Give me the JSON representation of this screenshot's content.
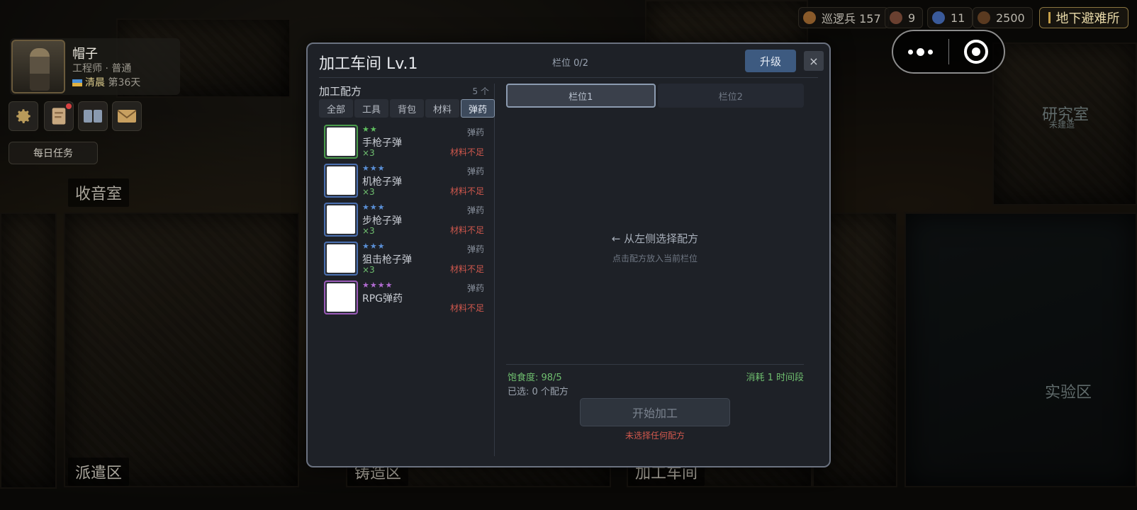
{
  "player": {
    "name": "帽子",
    "role": "工程师 · 普通",
    "time_of_day": "清晨",
    "day": "第36天"
  },
  "hud": {
    "daily_tasks": "每日任务",
    "notification_badge": true
  },
  "resources": [
    {
      "icon": "patrol-icon",
      "label": "巡逻兵 157",
      "color": "#8a5a2a"
    },
    {
      "icon": "ore-icon",
      "label": "9",
      "color": "#6a4030"
    },
    {
      "icon": "crystal-icon",
      "label": "11",
      "color": "#3a5a9a"
    },
    {
      "icon": "coin-icon",
      "label": "2500",
      "color": "#5a3a20"
    }
  ],
  "location": "地下避难所",
  "rooms": {
    "radio": "收音室",
    "research": "研究室",
    "research_status": "未建造",
    "lab": "实验区",
    "dispatch": "派遣区",
    "forge": "铸造区",
    "workshop": "加工车间"
  },
  "modal": {
    "title": "加工车间  Lv.1",
    "slots_used": "栏位 0/2",
    "upgrade": "升级",
    "close": "×",
    "recipes_title": "加工配方",
    "recipes_count": "5 个",
    "tabs": [
      "全部",
      "工具",
      "背包",
      "材料",
      "弹药"
    ],
    "active_tab": 4,
    "recipes": [
      {
        "stars": "★★",
        "star_color": "#5fbf5f",
        "border": "#4b9c4b",
        "name": "手枪子弹",
        "qty": "×3",
        "category": "弹药",
        "status": "材料不足"
      },
      {
        "stars": "★★★",
        "star_color": "#5a8fd6",
        "border": "#4a6fb0",
        "name": "机枪子弹",
        "qty": "×3",
        "category": "弹药",
        "status": "材料不足"
      },
      {
        "stars": "★★★",
        "star_color": "#5a8fd6",
        "border": "#4a6fb0",
        "name": "步枪子弹",
        "qty": "×3",
        "category": "弹药",
        "status": "材料不足"
      },
      {
        "stars": "★★★",
        "star_color": "#5a8fd6",
        "border": "#4a6fb0",
        "name": "狙击枪子弹",
        "qty": "×3",
        "category": "弹药",
        "status": "材料不足"
      },
      {
        "stars": "★★★★",
        "star_color": "#b06ad0",
        "border": "#9a5ab8",
        "name": "RPG弹药",
        "qty": "",
        "category": "弹药",
        "status": "材料不足"
      }
    ],
    "slot_tabs": [
      "栏位1",
      "栏位2"
    ],
    "hint_main": "← 从左侧选择配方",
    "hint_sub": "点击配方放入当前栏位",
    "satiety": "饱食度: 98/5",
    "cost": "消耗 1 时间段",
    "selected": "已选: 0 个配方",
    "start": "开始加工",
    "no_recipe": "未选择任何配方"
  }
}
